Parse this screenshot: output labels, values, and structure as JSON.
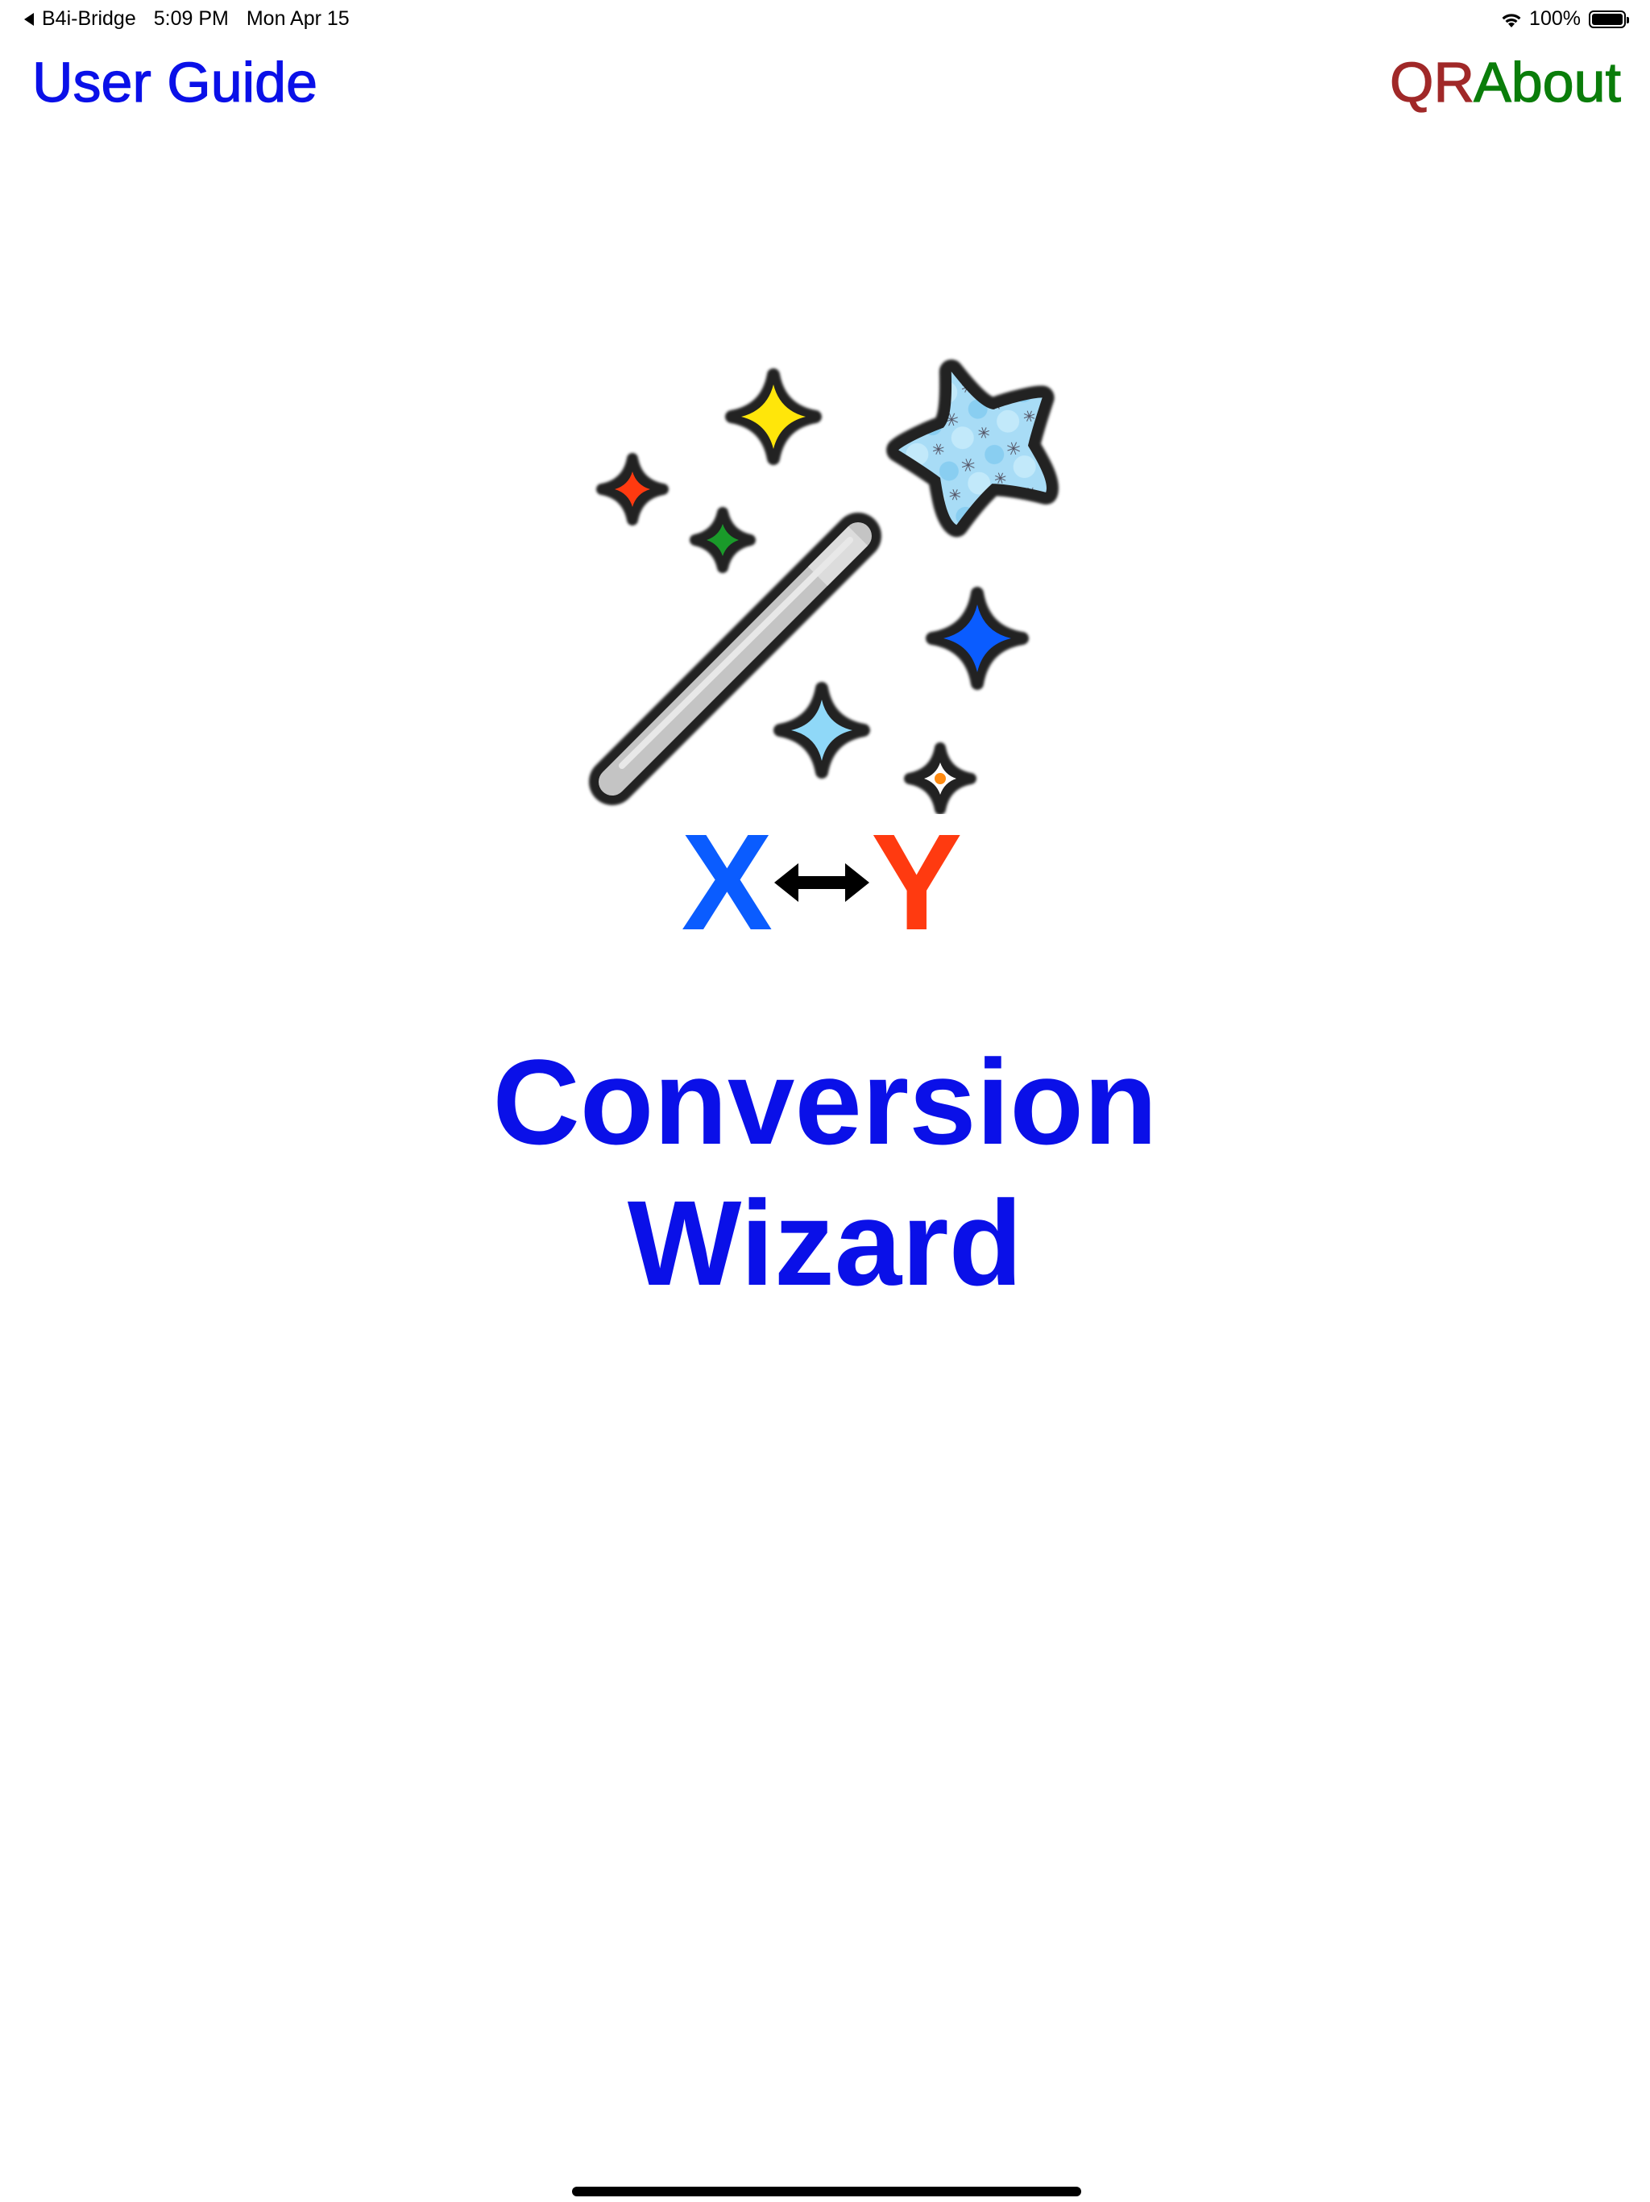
{
  "status_bar": {
    "back_app": "B4i-Bridge",
    "time": "5:09 PM",
    "date": "Mon Apr 15",
    "battery_percent_label": "100%",
    "battery_level": 1.0
  },
  "nav": {
    "user_guide_label": "User Guide",
    "qr_label": "QR",
    "about_label": "About"
  },
  "logo": {
    "x_letter": "X",
    "y_letter": "Y",
    "icon": "magic-wand-icon"
  },
  "title": {
    "line1": "Conversion",
    "line2": "Wizard"
  },
  "colors": {
    "user_guide": "#0a10e8",
    "qr": "#a02828",
    "about": "#0a7d0a",
    "title": "#0a10e8",
    "x_letter": "#0a5cff",
    "y_letter": "#ff3a10"
  }
}
